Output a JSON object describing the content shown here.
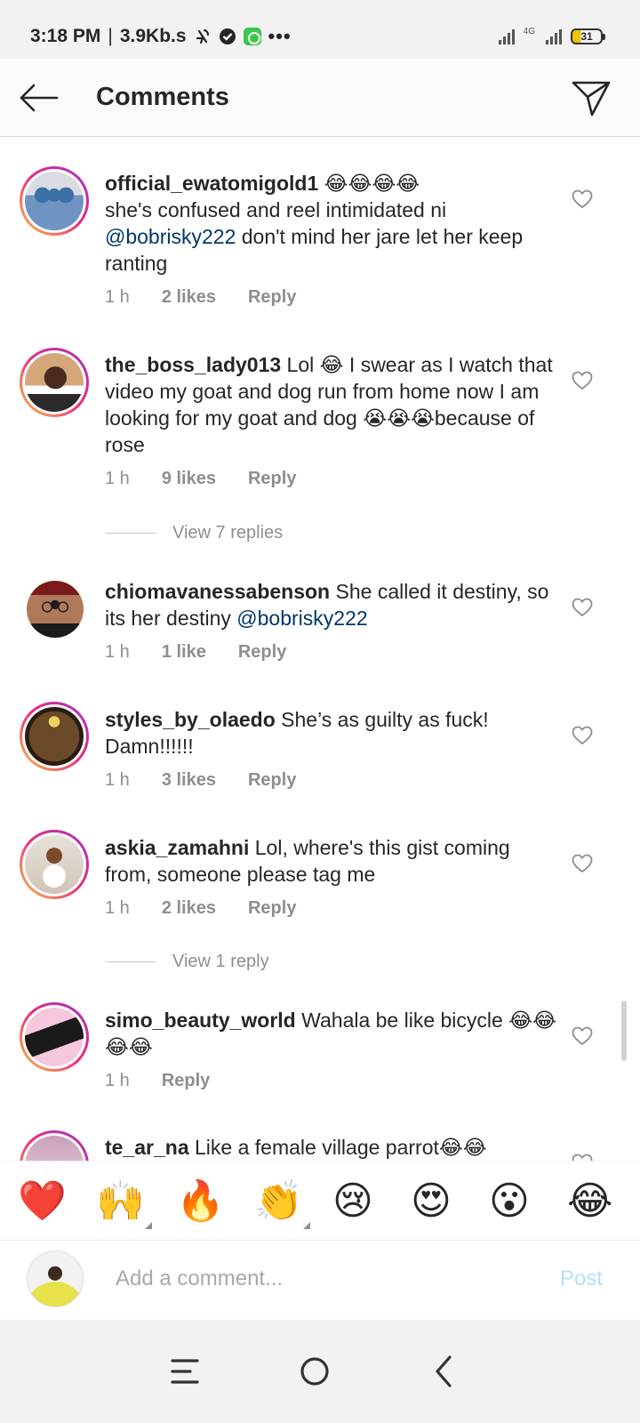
{
  "status_bar": {
    "time": "3:18 PM",
    "speed": "3.9Kb.s",
    "network": "4G",
    "battery": "31"
  },
  "header": {
    "title": "Comments"
  },
  "comments": [
    {
      "username": "official_ewatomigold1",
      "text_lines": [
        "😂😂😂😂",
        "she's confused and reel intimidated ni ",
        " don't mind her jare let her keep ranting"
      ],
      "text": " 😂😂😂😂",
      "line2": "she's confused and reel intimidated ni",
      "mention": "@bobrisky222",
      "line3": " don't mind her jare let her keep ranting",
      "time": "1 h",
      "likes": "2 likes",
      "reply": "Reply"
    },
    {
      "username": "the_boss_lady013",
      "text": " Lol 😂 I swear as I watch that video my goat  and dog run from home now I am looking for my goat and  dog 😭😭😭because of rose",
      "time": "1 h",
      "likes": "9 likes",
      "reply": "Reply",
      "view_replies": "View 7 replies"
    },
    {
      "username": "chiomavanessabenson",
      "text": " She called it destiny, so its her destiny ",
      "mention": "@bobrisky222",
      "time": "1 h",
      "likes": "1 like",
      "reply": "Reply"
    },
    {
      "username": "styles_by_olaedo",
      "text": " She’s as guilty as fuck! Damn!!!!!!",
      "time": "1 h",
      "likes": "3 likes",
      "reply": "Reply"
    },
    {
      "username": "askia_zamahni",
      "text": " Lol, where's this gist coming from, someone please tag me",
      "time": "1 h",
      "likes": "2 likes",
      "reply": "Reply",
      "view_replies": "View 1 reply"
    },
    {
      "username": "simo_beauty_world",
      "text": " Wahala be like bicycle 😂😂😂😂",
      "time": "1 h",
      "reply": "Reply"
    },
    {
      "username": "te_ar_na",
      "text": " Like a female village parrot😂😂"
    }
  ],
  "emoji_bar": [
    "❤️",
    "🙌",
    "🔥",
    "👏",
    "😢",
    "😍",
    "😮",
    "😂"
  ],
  "composer": {
    "placeholder": "Add a comment...",
    "post_label": "Post"
  }
}
